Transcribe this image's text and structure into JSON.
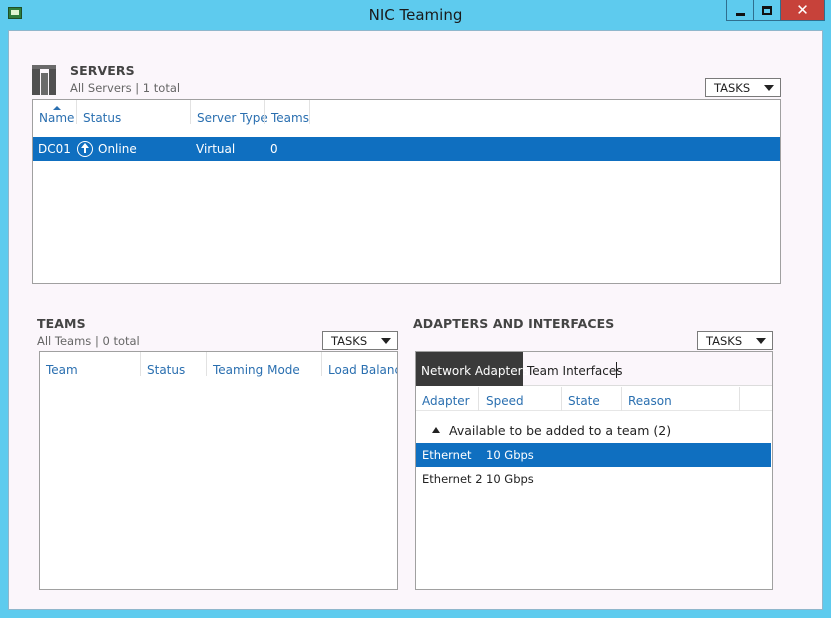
{
  "window": {
    "title": "NIC Teaming",
    "colors": {
      "titlebar": "#5ecbee",
      "close": "#c7423a",
      "selection": "#0f6fc0",
      "header_text": "#2a6fb0"
    }
  },
  "servers": {
    "title": "SERVERS",
    "subtitle": "All Servers | 1 total",
    "tasks_label": "TASKS",
    "columns": [
      "Name",
      "Status",
      "Server Type",
      "Teams"
    ],
    "rows": [
      {
        "name": "DC01",
        "status": "Online",
        "status_icon": "online-arrow-icon",
        "server_type": "Virtual",
        "teams": "0",
        "selected": true
      }
    ]
  },
  "teams": {
    "title": "TEAMS",
    "subtitle": "All Teams | 0 total",
    "tasks_label": "TASKS",
    "columns": [
      "Team",
      "Status",
      "Teaming Mode",
      "Load Balancin"
    ]
  },
  "adapters": {
    "title": "ADAPTERS AND INTERFACES",
    "tasks_label": "TASKS",
    "tabs": [
      {
        "label": "Network Adapters",
        "active": true
      },
      {
        "label": "Team Interfaces",
        "active": false
      }
    ],
    "columns": [
      "Adapter",
      "Speed",
      "State",
      "Reason"
    ],
    "group_label": "Available to be added to a team (2)",
    "rows": [
      {
        "adapter": "Ethernet",
        "speed": "10 Gbps",
        "selected": true
      },
      {
        "adapter": "Ethernet 2",
        "speed": "10 Gbps",
        "selected": false
      }
    ]
  }
}
